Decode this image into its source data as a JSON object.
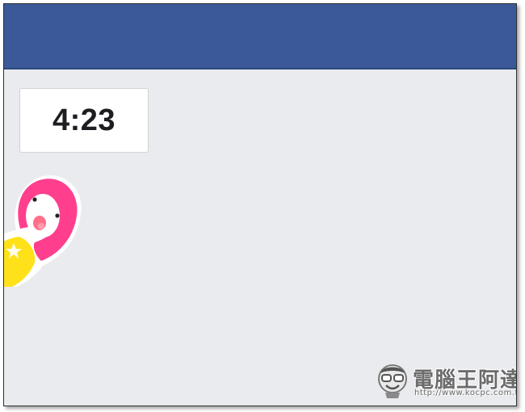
{
  "colors": {
    "header_bar": "#3b5998",
    "page_background": "#e9ebee",
    "timer_background": "#ffffff",
    "sticker_hair": "#ff3f8e",
    "sticker_body": "#ffe11a"
  },
  "timer": {
    "time": "4:23"
  },
  "sticker": {
    "icon": "girl-sticker-icon"
  },
  "watermark": {
    "title": "電腦王阿達",
    "url": "http://www.kocpc.com.tw"
  }
}
